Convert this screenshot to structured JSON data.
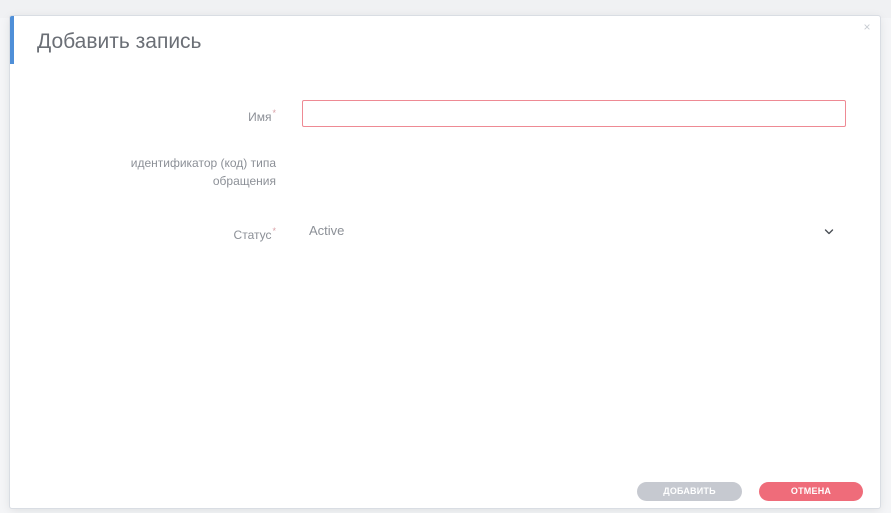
{
  "dialog": {
    "title": "Добавить запись",
    "close_label": "×"
  },
  "form": {
    "name": {
      "label": "Имя",
      "required_mark": "*",
      "value": "",
      "placeholder": ""
    },
    "code": {
      "label_line1": "идентификатор (код) типа",
      "label_line2": "обращения"
    },
    "status": {
      "label": "Статус",
      "required_mark": "*",
      "value": "Active",
      "icon": "chevron-down-icon"
    }
  },
  "buttons": {
    "add_label": "ДОБАВИТЬ",
    "cancel_label": "ОТМЕНА"
  },
  "colors": {
    "accent": "#4f8fd8",
    "add_button_disabled": "#c6c9d0",
    "cancel_button": "#ef6c7a",
    "input_error_border": "#ee8a94"
  }
}
